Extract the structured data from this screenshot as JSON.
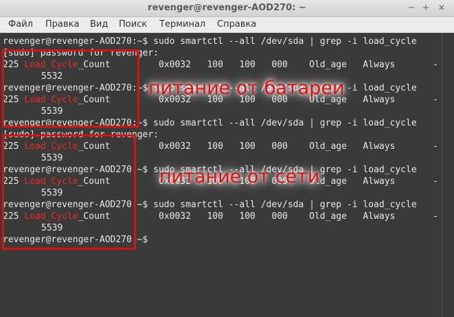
{
  "window": {
    "title": "revenger@revenger-AOD270: ~",
    "controls": {
      "minimize": "−",
      "maximize": "+",
      "close": "×"
    }
  },
  "menu": {
    "items": [
      "Файл",
      "Правка",
      "Вид",
      "Поиск",
      "Терминал",
      "Справка"
    ]
  },
  "terminal": {
    "prompt": "revenger@revenger-AOD270:~$",
    "command": " sudo smartctl --all /dev/sda | grep -i load_cycle",
    "sudo_prompt": "[sudo] password for revenger:",
    "attr_prefix": "225 ",
    "attr_red": "Load_Cycle",
    "attr_suffix": "_Count",
    "attr_fields": "         0x0032   100   100   000    Old_age   Always       -",
    "values": [
      "5532",
      "5539",
      "5539",
      "5539",
      "5539"
    ]
  },
  "annotations": {
    "battery": "питание от батареи",
    "mains": "питание от сети"
  },
  "colors": {
    "terminal_bg": "#3a3a3a",
    "terminal_fg": "#e8e8e8",
    "match_red": "#ef2929",
    "annotation_red": "#e01010"
  }
}
